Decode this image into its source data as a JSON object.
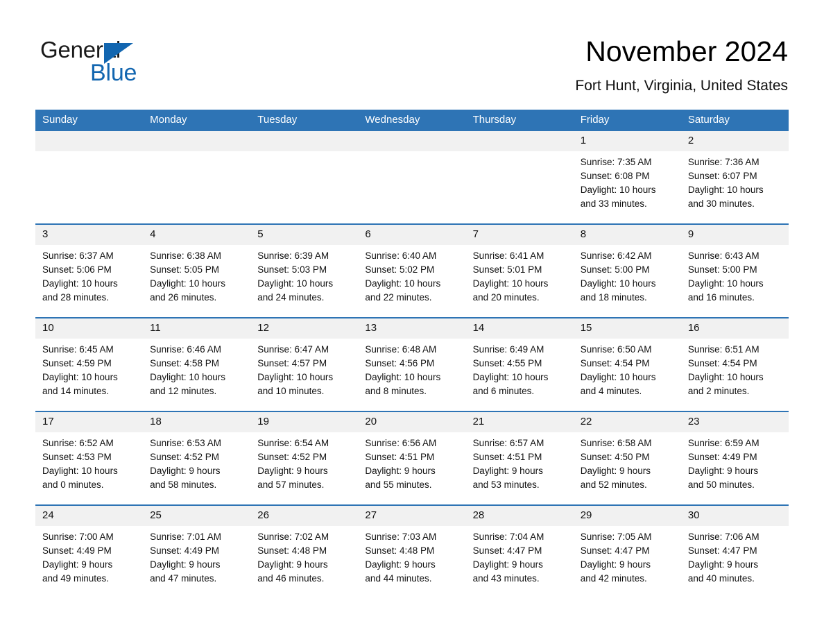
{
  "logo": {
    "word1": "General",
    "word2": "Blue",
    "triangle_color": "#1266b0",
    "icon": "triangle-icon"
  },
  "header": {
    "title": "November 2024",
    "location": "Fort Hunt, Virginia, United States"
  },
  "theme": {
    "accent": "#2e74b5",
    "daynum_bg": "#f1f1f1",
    "text": "#111111",
    "page_bg": "#ffffff"
  },
  "calendar": {
    "weekday_headers": [
      "Sunday",
      "Monday",
      "Tuesday",
      "Wednesday",
      "Thursday",
      "Friday",
      "Saturday"
    ],
    "weeks": [
      [
        {
          "day": "",
          "empty": true,
          "sunrise": "",
          "sunset": "",
          "daylight_1": "",
          "daylight_2": ""
        },
        {
          "day": "",
          "empty": true,
          "sunrise": "",
          "sunset": "",
          "daylight_1": "",
          "daylight_2": ""
        },
        {
          "day": "",
          "empty": true,
          "sunrise": "",
          "sunset": "",
          "daylight_1": "",
          "daylight_2": ""
        },
        {
          "day": "",
          "empty": true,
          "sunrise": "",
          "sunset": "",
          "daylight_1": "",
          "daylight_2": ""
        },
        {
          "day": "",
          "empty": true,
          "sunrise": "",
          "sunset": "",
          "daylight_1": "",
          "daylight_2": ""
        },
        {
          "day": "1",
          "empty": false,
          "sunrise": "Sunrise: 7:35 AM",
          "sunset": "Sunset: 6:08 PM",
          "daylight_1": "Daylight: 10 hours",
          "daylight_2": "and 33 minutes."
        },
        {
          "day": "2",
          "empty": false,
          "sunrise": "Sunrise: 7:36 AM",
          "sunset": "Sunset: 6:07 PM",
          "daylight_1": "Daylight: 10 hours",
          "daylight_2": "and 30 minutes."
        }
      ],
      [
        {
          "day": "3",
          "empty": false,
          "sunrise": "Sunrise: 6:37 AM",
          "sunset": "Sunset: 5:06 PM",
          "daylight_1": "Daylight: 10 hours",
          "daylight_2": "and 28 minutes."
        },
        {
          "day": "4",
          "empty": false,
          "sunrise": "Sunrise: 6:38 AM",
          "sunset": "Sunset: 5:05 PM",
          "daylight_1": "Daylight: 10 hours",
          "daylight_2": "and 26 minutes."
        },
        {
          "day": "5",
          "empty": false,
          "sunrise": "Sunrise: 6:39 AM",
          "sunset": "Sunset: 5:03 PM",
          "daylight_1": "Daylight: 10 hours",
          "daylight_2": "and 24 minutes."
        },
        {
          "day": "6",
          "empty": false,
          "sunrise": "Sunrise: 6:40 AM",
          "sunset": "Sunset: 5:02 PM",
          "daylight_1": "Daylight: 10 hours",
          "daylight_2": "and 22 minutes."
        },
        {
          "day": "7",
          "empty": false,
          "sunrise": "Sunrise: 6:41 AM",
          "sunset": "Sunset: 5:01 PM",
          "daylight_1": "Daylight: 10 hours",
          "daylight_2": "and 20 minutes."
        },
        {
          "day": "8",
          "empty": false,
          "sunrise": "Sunrise: 6:42 AM",
          "sunset": "Sunset: 5:00 PM",
          "daylight_1": "Daylight: 10 hours",
          "daylight_2": "and 18 minutes."
        },
        {
          "day": "9",
          "empty": false,
          "sunrise": "Sunrise: 6:43 AM",
          "sunset": "Sunset: 5:00 PM",
          "daylight_1": "Daylight: 10 hours",
          "daylight_2": "and 16 minutes."
        }
      ],
      [
        {
          "day": "10",
          "empty": false,
          "sunrise": "Sunrise: 6:45 AM",
          "sunset": "Sunset: 4:59 PM",
          "daylight_1": "Daylight: 10 hours",
          "daylight_2": "and 14 minutes."
        },
        {
          "day": "11",
          "empty": false,
          "sunrise": "Sunrise: 6:46 AM",
          "sunset": "Sunset: 4:58 PM",
          "daylight_1": "Daylight: 10 hours",
          "daylight_2": "and 12 minutes."
        },
        {
          "day": "12",
          "empty": false,
          "sunrise": "Sunrise: 6:47 AM",
          "sunset": "Sunset: 4:57 PM",
          "daylight_1": "Daylight: 10 hours",
          "daylight_2": "and 10 minutes."
        },
        {
          "day": "13",
          "empty": false,
          "sunrise": "Sunrise: 6:48 AM",
          "sunset": "Sunset: 4:56 PM",
          "daylight_1": "Daylight: 10 hours",
          "daylight_2": "and 8 minutes."
        },
        {
          "day": "14",
          "empty": false,
          "sunrise": "Sunrise: 6:49 AM",
          "sunset": "Sunset: 4:55 PM",
          "daylight_1": "Daylight: 10 hours",
          "daylight_2": "and 6 minutes."
        },
        {
          "day": "15",
          "empty": false,
          "sunrise": "Sunrise: 6:50 AM",
          "sunset": "Sunset: 4:54 PM",
          "daylight_1": "Daylight: 10 hours",
          "daylight_2": "and 4 minutes."
        },
        {
          "day": "16",
          "empty": false,
          "sunrise": "Sunrise: 6:51 AM",
          "sunset": "Sunset: 4:54 PM",
          "daylight_1": "Daylight: 10 hours",
          "daylight_2": "and 2 minutes."
        }
      ],
      [
        {
          "day": "17",
          "empty": false,
          "sunrise": "Sunrise: 6:52 AM",
          "sunset": "Sunset: 4:53 PM",
          "daylight_1": "Daylight: 10 hours",
          "daylight_2": "and 0 minutes."
        },
        {
          "day": "18",
          "empty": false,
          "sunrise": "Sunrise: 6:53 AM",
          "sunset": "Sunset: 4:52 PM",
          "daylight_1": "Daylight: 9 hours",
          "daylight_2": "and 58 minutes."
        },
        {
          "day": "19",
          "empty": false,
          "sunrise": "Sunrise: 6:54 AM",
          "sunset": "Sunset: 4:52 PM",
          "daylight_1": "Daylight: 9 hours",
          "daylight_2": "and 57 minutes."
        },
        {
          "day": "20",
          "empty": false,
          "sunrise": "Sunrise: 6:56 AM",
          "sunset": "Sunset: 4:51 PM",
          "daylight_1": "Daylight: 9 hours",
          "daylight_2": "and 55 minutes."
        },
        {
          "day": "21",
          "empty": false,
          "sunrise": "Sunrise: 6:57 AM",
          "sunset": "Sunset: 4:51 PM",
          "daylight_1": "Daylight: 9 hours",
          "daylight_2": "and 53 minutes."
        },
        {
          "day": "22",
          "empty": false,
          "sunrise": "Sunrise: 6:58 AM",
          "sunset": "Sunset: 4:50 PM",
          "daylight_1": "Daylight: 9 hours",
          "daylight_2": "and 52 minutes."
        },
        {
          "day": "23",
          "empty": false,
          "sunrise": "Sunrise: 6:59 AM",
          "sunset": "Sunset: 4:49 PM",
          "daylight_1": "Daylight: 9 hours",
          "daylight_2": "and 50 minutes."
        }
      ],
      [
        {
          "day": "24",
          "empty": false,
          "sunrise": "Sunrise: 7:00 AM",
          "sunset": "Sunset: 4:49 PM",
          "daylight_1": "Daylight: 9 hours",
          "daylight_2": "and 49 minutes."
        },
        {
          "day": "25",
          "empty": false,
          "sunrise": "Sunrise: 7:01 AM",
          "sunset": "Sunset: 4:49 PM",
          "daylight_1": "Daylight: 9 hours",
          "daylight_2": "and 47 minutes."
        },
        {
          "day": "26",
          "empty": false,
          "sunrise": "Sunrise: 7:02 AM",
          "sunset": "Sunset: 4:48 PM",
          "daylight_1": "Daylight: 9 hours",
          "daylight_2": "and 46 minutes."
        },
        {
          "day": "27",
          "empty": false,
          "sunrise": "Sunrise: 7:03 AM",
          "sunset": "Sunset: 4:48 PM",
          "daylight_1": "Daylight: 9 hours",
          "daylight_2": "and 44 minutes."
        },
        {
          "day": "28",
          "empty": false,
          "sunrise": "Sunrise: 7:04 AM",
          "sunset": "Sunset: 4:47 PM",
          "daylight_1": "Daylight: 9 hours",
          "daylight_2": "and 43 minutes."
        },
        {
          "day": "29",
          "empty": false,
          "sunrise": "Sunrise: 7:05 AM",
          "sunset": "Sunset: 4:47 PM",
          "daylight_1": "Daylight: 9 hours",
          "daylight_2": "and 42 minutes."
        },
        {
          "day": "30",
          "empty": false,
          "sunrise": "Sunrise: 7:06 AM",
          "sunset": "Sunset: 4:47 PM",
          "daylight_1": "Daylight: 9 hours",
          "daylight_2": "and 40 minutes."
        }
      ]
    ]
  }
}
